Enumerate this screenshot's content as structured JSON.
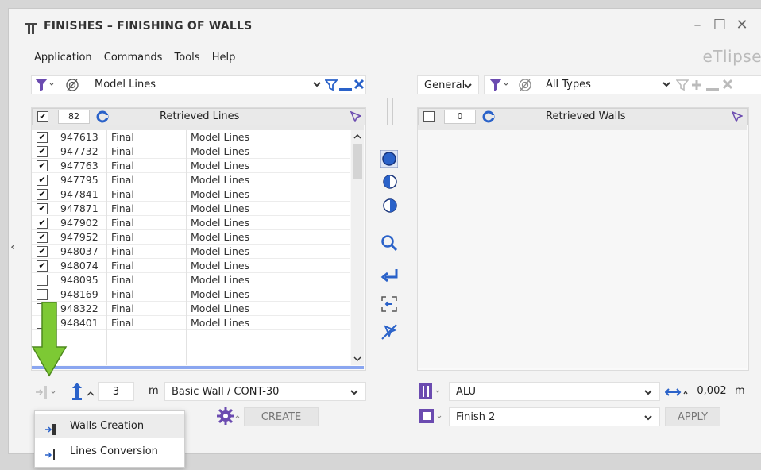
{
  "window": {
    "title": "FINISHES – FINISHING OF WALLS",
    "logo_glyph": "📐",
    "brand": "eTlipse",
    "controls": {
      "minimize": "–",
      "maximize": "☐",
      "close": "✕"
    }
  },
  "menu": [
    "Application",
    "Commands",
    "Tools",
    "Help"
  ],
  "left": {
    "filter_value": "Model Lines",
    "count": "82",
    "header_title": "Retrieved Lines",
    "rows": [
      {
        "id": "947613",
        "status": "Final",
        "type": "Model Lines",
        "checked": true
      },
      {
        "id": "947732",
        "status": "Final",
        "type": "Model Lines",
        "checked": true
      },
      {
        "id": "947763",
        "status": "Final",
        "type": "Model Lines",
        "checked": true
      },
      {
        "id": "947795",
        "status": "Final",
        "type": "Model Lines",
        "checked": true
      },
      {
        "id": "947841",
        "status": "Final",
        "type": "Model Lines",
        "checked": true
      },
      {
        "id": "947871",
        "status": "Final",
        "type": "Model Lines",
        "checked": true
      },
      {
        "id": "947902",
        "status": "Final",
        "type": "Model Lines",
        "checked": true
      },
      {
        "id": "947952",
        "status": "Final",
        "type": "Model Lines",
        "checked": true
      },
      {
        "id": "948037",
        "status": "Final",
        "type": "Model Lines",
        "checked": true
      },
      {
        "id": "948074",
        "status": "Final",
        "type": "Model Lines",
        "checked": true
      },
      {
        "id": "948095",
        "status": "Final",
        "type": "Model Lines",
        "checked": false
      },
      {
        "id": "948169",
        "status": "Final",
        "type": "Model Lines",
        "checked": false
      },
      {
        "id": "948322",
        "status": "Final",
        "type": "Model Lines",
        "checked": false
      },
      {
        "id": "948401",
        "status": "Final",
        "type": "Model Lines",
        "checked": false
      }
    ],
    "height_value": "3",
    "height_unit": "m",
    "wall_type": "Basic Wall / CONT-30",
    "create_label": "CREATE"
  },
  "right": {
    "general_label": "General",
    "filter_value": "All Types",
    "count": "0",
    "header_title": "Retrieved Walls",
    "material": "ALU",
    "offset_value": "0,002",
    "offset_unit": "m",
    "finish": "Finish 2",
    "apply_label": "APPLY"
  },
  "popup": {
    "items": [
      "Walls Creation",
      "Lines Conversion"
    ]
  },
  "colors": {
    "accent_blue": "#2a62c9",
    "filter_purple": "#6b4bb0",
    "arrow_green": "#7dc934",
    "selection_bar": "#8aa6f0"
  }
}
